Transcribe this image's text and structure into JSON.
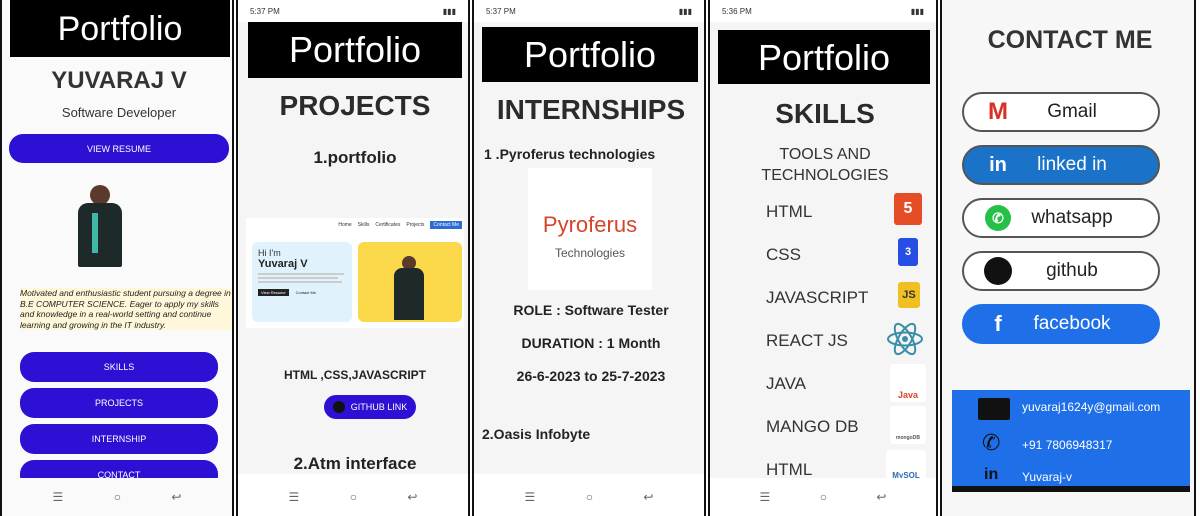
{
  "s1": {
    "header": "Portfolio",
    "name": "YUVARAJ V",
    "role": "Software Developer",
    "resume_button": "VIEW RESUME",
    "bio": "Motivated and enthusiastic student pursuing a degree in B.E COMPUTER SCIENCE. Eager to apply my skills and knowledge in a real-world setting and continue learning and growing in the IT industry.",
    "nav": [
      "SKILLS",
      "PROJECTS",
      "INTERNSHIP",
      "CONTACT"
    ]
  },
  "s2": {
    "status_time": "5:37 PM",
    "header": "Portfolio",
    "section_title": "PROJECTS",
    "project1": "1.portfolio",
    "preview_greeting": "Hi I'm",
    "preview_name": "Yuvaraj V",
    "preview_nav": [
      "Home",
      "Skills",
      "Certificates",
      "Projects",
      "Contact Me"
    ],
    "preview_btn1": "View Resume",
    "preview_btn2": "Contact Me",
    "tech": "HTML ,CSS,JAVASCRIPT",
    "github_button": "GITHUB LINK",
    "project2": "2.Atm interface"
  },
  "s3": {
    "status_time": "5:37 PM",
    "header": "Portfolio",
    "section_title": "INTERNSHIPS",
    "intern1": "1 .Pyroferus technologies",
    "logo_top": "Pyroferus",
    "logo_bottom": "Technologies",
    "role": "ROLE : Software Tester",
    "duration": "DURATION : 1 Month",
    "dates": "26-6-2023 to 25-7-2023",
    "intern2": "2.Oasis Infobyte"
  },
  "s4": {
    "status_time": "5:36 PM",
    "header": "Portfolio",
    "section_title": "SKILLS",
    "subtitle_line1": "TOOLS AND",
    "subtitle_line2": "TECHNOLOGIES",
    "skills": [
      "HTML",
      "CSS",
      "JAVASCRIPT",
      "REACT JS",
      "JAVA",
      "MANGO DB",
      "HTML"
    ],
    "icon_labels": [
      "5",
      "3",
      "JS",
      "",
      "Java",
      "mongoDB",
      "MySQL"
    ]
  },
  "s5": {
    "title": "CONTACT ME",
    "buttons": [
      "Gmail",
      "linked in",
      "whatsapp",
      "github",
      "facebook"
    ],
    "email": "yuvaraj1624y@gmail.com",
    "phone": "+91 7806948317",
    "linkedin": "Yuvaraj-v"
  },
  "colors": {
    "accent": "#2c10d4",
    "contact_blue": "#1f6fe8",
    "linkedin_blue": "#1a73c8"
  }
}
